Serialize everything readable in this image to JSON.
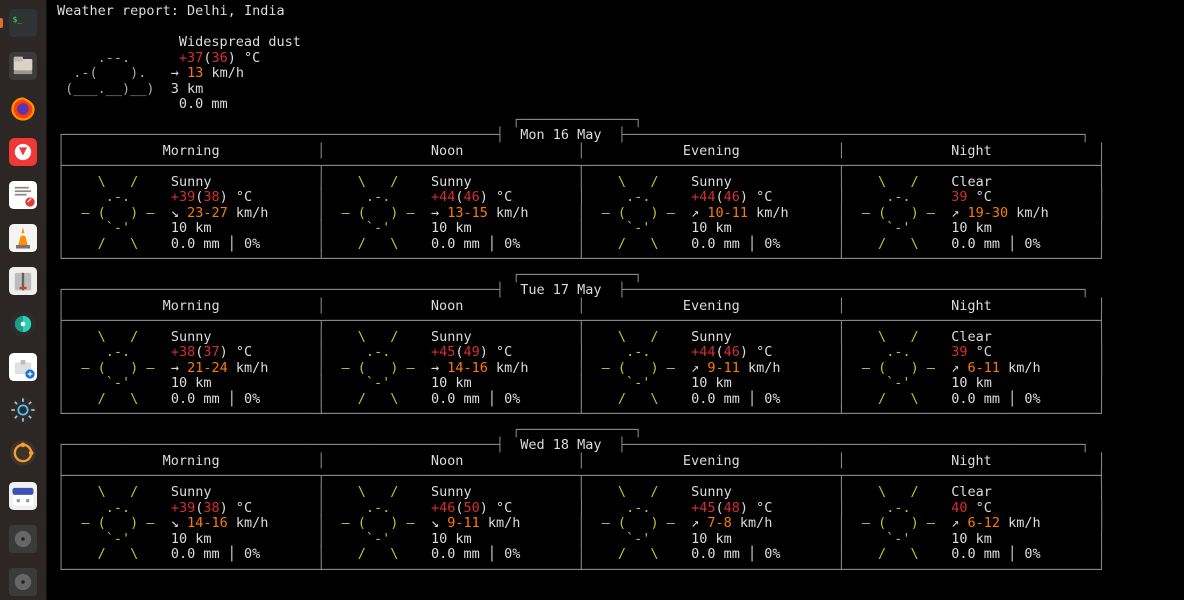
{
  "dock": {
    "items": [
      {
        "name": "terminal-icon",
        "bg": "#2e3436"
      },
      {
        "name": "files-icon",
        "bg": "#3b3b3b"
      },
      {
        "name": "firefox-icon",
        "bg": "#1f1431"
      },
      {
        "name": "vivaldi-icon",
        "bg": "#e5313c"
      },
      {
        "name": "text-editor-icon",
        "bg": "#ffffff"
      },
      {
        "name": "vlc-icon",
        "bg": "#f0f0f0"
      },
      {
        "name": "archive-icon",
        "bg": "#eeeeee"
      },
      {
        "name": "screenshot-icon",
        "bg": "#17a398"
      },
      {
        "name": "software-icon",
        "bg": "#ffffff"
      },
      {
        "name": "settings-icon",
        "bg": "#2b2b2b"
      },
      {
        "name": "planner-icon",
        "bg": "#3b2f2a"
      },
      {
        "name": "calendar-icon",
        "bg": "#f0f0f0"
      },
      {
        "name": "disk1-icon",
        "bg": "#3a3a3a"
      },
      {
        "name": "disk2-icon",
        "bg": "#3a3a3a"
      }
    ]
  },
  "header": {
    "title_prefix": "Weather report: ",
    "location": "Delhi, India"
  },
  "current": {
    "condition": "Widespread dust",
    "temp_hi": "+37",
    "temp_lo": "36",
    "temp_unit": " °C",
    "wind_dir": "→ ",
    "wind": "13",
    "wind_unit": " km/h",
    "visibility": "3 km",
    "precip": "0.0 mm",
    "ascii": [
      "     .--.    ",
      "  .-(    ). ",
      " (___.__)__)"
    ]
  },
  "labels": {
    "morning": "Morning",
    "noon": "Noon",
    "evening": "Evening",
    "night": "Night",
    "vis": "10 km",
    "precip": "0.0 mm │ 0%",
    "kmh": " km/h"
  },
  "sun_art": [
    "   \\   /    ",
    "    .-.     ",
    " ― (   ) ―  ",
    "    `-'     ",
    "   /   \\    "
  ],
  "days": [
    {
      "date": "Mon 16 May",
      "periods": [
        {
          "cond": "Sunny",
          "t1": "+39",
          "t2": "38",
          "dir": "↘ ",
          "wind": "23-27"
        },
        {
          "cond": "Sunny",
          "t1": "+44",
          "t2": "46",
          "dir": "→ ",
          "wind": "13-15"
        },
        {
          "cond": "Sunny",
          "t1": "+44",
          "t2": "46",
          "dir": "↗ ",
          "wind": "10-11"
        },
        {
          "cond": "Clear",
          "t1": "39",
          "t2": "",
          "dir": "↗ ",
          "wind": "19-30"
        }
      ]
    },
    {
      "date": "Tue 17 May",
      "periods": [
        {
          "cond": "Sunny",
          "t1": "+38",
          "t2": "37",
          "dir": "→ ",
          "wind": "21-24"
        },
        {
          "cond": "Sunny",
          "t1": "+45",
          "t2": "49",
          "dir": "→ ",
          "wind": "14-16"
        },
        {
          "cond": "Sunny",
          "t1": "+44",
          "t2": "46",
          "dir": "↗ ",
          "wind": "9-11"
        },
        {
          "cond": "Clear",
          "t1": "39",
          "t2": "",
          "dir": "↗ ",
          "wind": "6-11"
        }
      ]
    },
    {
      "date": "Wed 18 May",
      "periods": [
        {
          "cond": "Sunny",
          "t1": "+39",
          "t2": "38",
          "dir": "↘ ",
          "wind": "14-16"
        },
        {
          "cond": "Sunny",
          "t1": "+46",
          "t2": "50",
          "dir": "↘ ",
          "wind": "9-11"
        },
        {
          "cond": "Sunny",
          "t1": "+45",
          "t2": "48",
          "dir": "↗ ",
          "wind": "7-8"
        },
        {
          "cond": "Clear",
          "t1": "40",
          "t2": "",
          "dir": "↗ ",
          "wind": "6-12"
        }
      ]
    }
  ]
}
